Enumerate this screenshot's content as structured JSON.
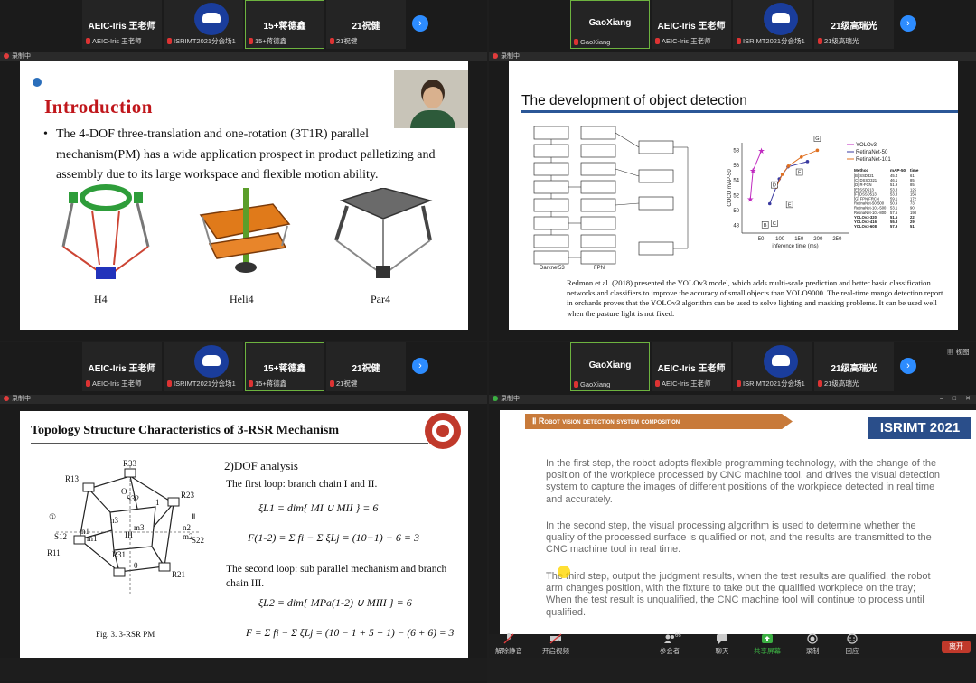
{
  "q1": {
    "tiles": [
      {
        "name": "AEIC-Iris 王老师",
        "sub": "AEIC-Iris 王老师"
      },
      {
        "name": "",
        "sub": "ISRIMT2021分会场1"
      },
      {
        "name": "15+蒋德鑫",
        "sub": "15+蒋德鑫"
      },
      {
        "name": "21祝健",
        "sub": "21祝健"
      }
    ],
    "rec_label": "录制中",
    "slide": {
      "title": "Introduction",
      "bullet": "The 4-DOF three-translation and one-rotation (3T1R) parallel mechanism(PM) has a wide application prospect in product palletizing and assembly due to its large workspace and flexible motion ability.",
      "labels": [
        "H4",
        "Heli4",
        "Par4"
      ]
    }
  },
  "q2": {
    "tiles": [
      {
        "name": "GaoXiang",
        "sub": "GaoXiang"
      },
      {
        "name": "AEIC-Iris 王老师",
        "sub": "AEIC-Iris 王老师"
      },
      {
        "name": "",
        "sub": "ISRIMT2021分会场1"
      },
      {
        "name": "21级高瑞光",
        "sub": "21级高瑞光"
      }
    ],
    "rec_label": "录制中",
    "slide": {
      "title": "The development of object detection",
      "diagram_left_label": "Darknet53",
      "diagram_mid_label": "FPN",
      "para": "Redmon et al. (2018) presented the YOLOv3 model, which adds multi-scale prediction and better basic classification networks and classifiers to improve the accuracy of small objects than YOLO9000. The real-time mango detection report in orchards proves that the YOLOv3 algorithm can be used to solve lighting and masking problems. It can be used well when the pasture light is not fixed."
    }
  },
  "chart_data": {
    "type": "line",
    "xlabel": "inference time (ms)",
    "ylabel": "COCO mAP-50",
    "xlim": [
      0,
      280
    ],
    "ylim": [
      47,
      59
    ],
    "xticks": [
      50,
      100,
      150,
      200,
      250
    ],
    "yticks": [
      48,
      50,
      52,
      54,
      56,
      58
    ],
    "series": [
      {
        "name": "YOLOv3",
        "color": "#c02ac0",
        "x": [
          22,
          29,
          51
        ],
        "y": [
          51.5,
          55.3,
          57.9
        ]
      },
      {
        "name": "RetinaNet-50",
        "color": "#3a3aa0",
        "x": [
          73,
          90,
          98,
          121,
          172
        ],
        "y": [
          50.9,
          53.1,
          54.2,
          55.8,
          56.5
        ]
      },
      {
        "name": "RetinaNet-101",
        "color": "#e07020",
        "x": [
          90,
          106,
          122,
          156,
          198
        ],
        "y": [
          53.1,
          54.8,
          55.9,
          57.1,
          58.0
        ]
      }
    ],
    "points": [
      {
        "label": "B",
        "x": 61,
        "y": 48.1
      },
      {
        "label": "C",
        "x": 85,
        "y": 48.3
      },
      {
        "label": "D",
        "x": 85,
        "y": 53.4
      },
      {
        "label": "E",
        "x": 125,
        "y": 50.8
      },
      {
        "label": "F",
        "x": 151,
        "y": 55.1
      },
      {
        "label": "G",
        "x": 198,
        "y": 59.6
      }
    ],
    "table_header": [
      "Method",
      "mAP-50",
      "time"
    ],
    "table_rows": [
      [
        "[B] SSD321",
        "45.4",
        "61"
      ],
      [
        "[C] DSSD321",
        "46.1",
        "85"
      ],
      [
        "[D] R-FCN",
        "51.9",
        "85"
      ],
      [
        "[E] SSD513",
        "53.3",
        "125"
      ],
      [
        "[F] DSSD513",
        "53.3",
        "156"
      ],
      [
        "[G] FPN FRCN",
        "59.1",
        "172"
      ],
      [
        "RetinaNet-50-500",
        "50.9",
        "73"
      ],
      [
        "RetinaNet-101-500",
        "53.1",
        "90"
      ],
      [
        "RetinaNet-101-800",
        "57.5",
        "198"
      ],
      [
        "YOLOv3-320",
        "51.5",
        "22"
      ],
      [
        "YOLOv3-416",
        "55.3",
        "29"
      ],
      [
        "YOLOv3-608",
        "57.9",
        "51"
      ]
    ]
  },
  "q3": {
    "tiles": [
      {
        "name": "AEIC-Iris 王老师",
        "sub": "AEIC-Iris 王老师"
      },
      {
        "name": "",
        "sub": "ISRIMT2021分会场1"
      },
      {
        "name": "15+蒋德鑫",
        "sub": "15+蒋德鑫"
      },
      {
        "name": "21祝健",
        "sub": "21祝健"
      }
    ],
    "rec_label": "录制中",
    "slide": {
      "title": "Topology Structure Characteristics of 3-RSR Mechanism",
      "sub": "2)DOF analysis",
      "loop1": "The first loop: branch chain I and II.",
      "eq1": "ξL1 = dim{ MI ∪ MII } = 6",
      "eq2": "F(1-2) = Σ fi − Σ ξLj = (10−1) − 6 = 3",
      "loop2": "The second loop: sub parallel mechanism and branch chain III.",
      "eq3": "ξL2 = dim{ MPa(1-2) ∪ MIII } = 6",
      "eq4": "F = Σ fi − Σ ξLj = (10 − 1 + 5 + 1) − (6 + 6) = 3",
      "caption": "Fig. 3. 3-RSR PM"
    }
  },
  "q4": {
    "tiles": [
      {
        "name": "GaoXiang",
        "sub": "GaoXiang"
      },
      {
        "name": "AEIC-Iris 王老师",
        "sub": "AEIC-Iris 王老师"
      },
      {
        "name": "",
        "sub": "ISRIMT2021分会场1"
      },
      {
        "name": "21级高瑞光",
        "sub": "21级高瑞光"
      }
    ],
    "view_label": "视图",
    "rec_label": "录制中",
    "slide": {
      "header": "Ⅱ Robot vision detection system composition",
      "logo": "ISRIMT 2021",
      "p1": "In the first step, the robot adopts flexible programming technology, with the change of the position of the workpiece processed by CNC machine tool, and drives the visual detection system to capture the images of different positions of the workpiece detected in real time and accurately.",
      "p2": "In the second step, the visual processing algorithm is used to determine whether the quality of the processed surface is qualified or not, and the results are transmitted to the CNC machine tool in real time.",
      "p3": "The third step, output the judgment results, when the test results are qualified, the robot arm changes position, with the fixture to take out the qualified workpiece on the tray; When the test result is unqualified, the CNC machine tool will continue to process until qualified."
    }
  },
  "toolbar": {
    "mute": "解除静音",
    "video": "开启视频",
    "participants": "参会者",
    "participants_count": "66",
    "chat": "聊天",
    "share": "共享屏幕",
    "record": "录制",
    "reactions": "回应",
    "leave": "离开"
  }
}
